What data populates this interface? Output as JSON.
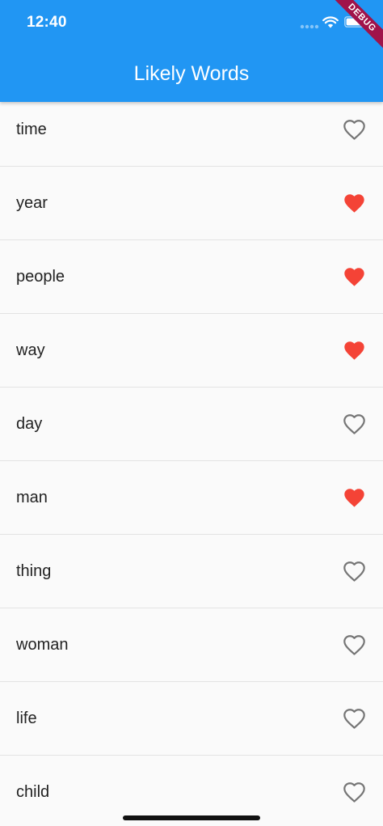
{
  "status_bar": {
    "time": "12:40"
  },
  "debug_banner": {
    "label": "DEBUG",
    "color": "#a0134a"
  },
  "app_bar": {
    "title": "Likely Words",
    "color": "#2196f3"
  },
  "colors": {
    "favorite": "#f44336",
    "not_favorite": "#757575"
  },
  "words": [
    {
      "word": "time",
      "favorite": false,
      "icon": "heart-outline-icon"
    },
    {
      "word": "year",
      "favorite": true,
      "icon": "heart-filled-icon"
    },
    {
      "word": "people",
      "favorite": true,
      "icon": "heart-filled-icon"
    },
    {
      "word": "way",
      "favorite": true,
      "icon": "heart-filled-icon"
    },
    {
      "word": "day",
      "favorite": false,
      "icon": "heart-outline-icon"
    },
    {
      "word": "man",
      "favorite": true,
      "icon": "heart-filled-icon"
    },
    {
      "word": "thing",
      "favorite": false,
      "icon": "heart-outline-icon"
    },
    {
      "word": "woman",
      "favorite": false,
      "icon": "heart-outline-icon"
    },
    {
      "word": "life",
      "favorite": false,
      "icon": "heart-outline-icon"
    },
    {
      "word": "child",
      "favorite": false,
      "icon": "heart-outline-icon"
    }
  ]
}
